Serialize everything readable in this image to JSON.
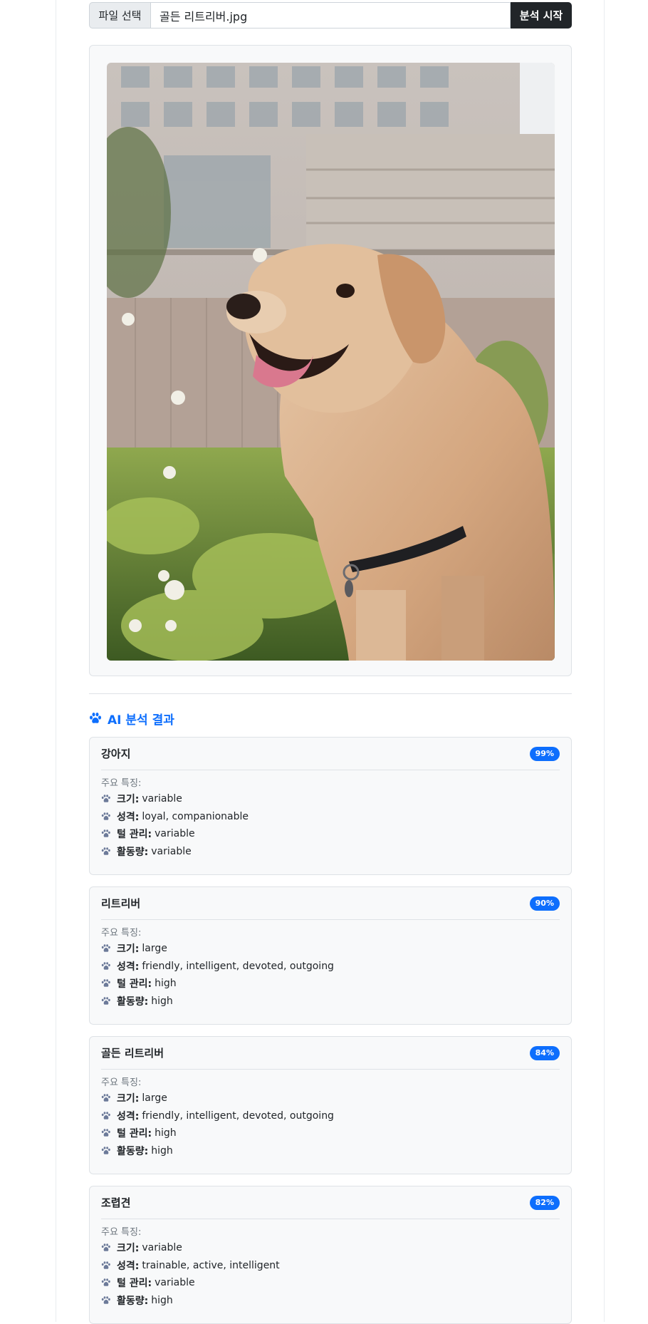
{
  "upload": {
    "choose_file_label": "파일 선택",
    "file_name": "골든 리트리버.jpg",
    "analyze_label": "분석 시작"
  },
  "results": {
    "heading": "AI 분석 결과",
    "features_label": "주요 특징:",
    "items": [
      {
        "title": "강아지",
        "confidence": "99%",
        "features": [
          {
            "key": "크기:",
            "value": "variable"
          },
          {
            "key": "성격:",
            "value": "loyal, companionable"
          },
          {
            "key": "털 관리:",
            "value": "variable"
          },
          {
            "key": "활동량:",
            "value": "variable"
          }
        ]
      },
      {
        "title": "리트리버",
        "confidence": "90%",
        "features": [
          {
            "key": "크기:",
            "value": "large"
          },
          {
            "key": "성격:",
            "value": "friendly, intelligent, devoted, outgoing"
          },
          {
            "key": "털 관리:",
            "value": "high"
          },
          {
            "key": "활동량:",
            "value": "high"
          }
        ]
      },
      {
        "title": "골든 리트리버",
        "confidence": "84%",
        "features": [
          {
            "key": "크기:",
            "value": "large"
          },
          {
            "key": "성격:",
            "value": "friendly, intelligent, devoted, outgoing"
          },
          {
            "key": "털 관리:",
            "value": "high"
          },
          {
            "key": "활동량:",
            "value": "high"
          }
        ]
      },
      {
        "title": "조렵견",
        "confidence": "82%",
        "features": [
          {
            "key": "크기:",
            "value": "variable"
          },
          {
            "key": "성격:",
            "value": "trainable, active, intelligent"
          },
          {
            "key": "털 관리:",
            "value": "variable"
          },
          {
            "key": "활동량:",
            "value": "high"
          }
        ]
      }
    ]
  },
  "icons": {
    "heading_icon": "paw-icon",
    "feature_icon": "paw-icon"
  },
  "colors": {
    "accent": "#0d6efd",
    "dark_button": "#212529"
  }
}
